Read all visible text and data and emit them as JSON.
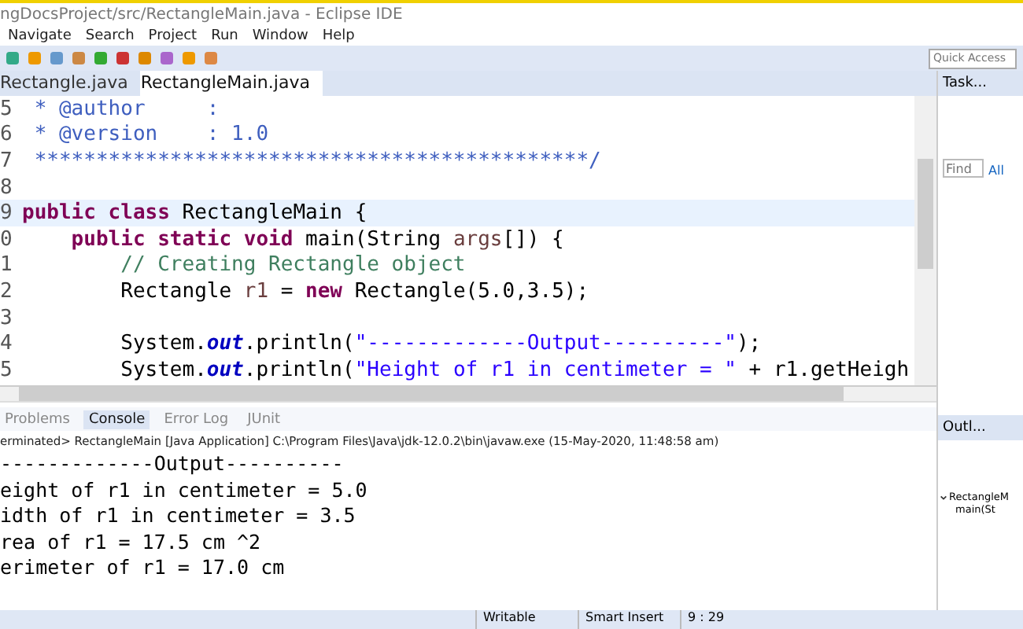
{
  "window": {
    "title": "ngDocsProject/src/RectangleMain.java - Eclipse IDE"
  },
  "menu": [
    "Navigate",
    "Search",
    "Project",
    "Run",
    "Window",
    "Help"
  ],
  "quick_access": {
    "placeholder": "Quick Access"
  },
  "editor_tabs": [
    {
      "label": "Rectangle.java",
      "selected": false
    },
    {
      "label": "RectangleMain.java",
      "selected": true
    }
  ],
  "code": [
    {
      "number": "5",
      "current": false,
      "tokens": [
        {
          "kind": "doc",
          "text": " * @author     :"
        }
      ]
    },
    {
      "number": "6",
      "current": false,
      "tokens": [
        {
          "kind": "doc",
          "text": " * @version    : 1.0"
        }
      ]
    },
    {
      "number": "7",
      "current": false,
      "tokens": [
        {
          "kind": "doc",
          "text": " *********************************************/"
        }
      ]
    },
    {
      "number": "8",
      "current": false
    },
    {
      "number": "9",
      "current": true,
      "tokens": [
        {
          "kind": "keyword",
          "text": "public class "
        },
        {
          "kind": "plain",
          "text": "RectangleMain {"
        }
      ]
    },
    {
      "number": "0",
      "current": false,
      "tokens": [
        {
          "kind": "keyword",
          "text": "    public static void "
        },
        {
          "kind": "plain",
          "text": "main(String "
        },
        {
          "kind": "param",
          "text": "args"
        },
        {
          "kind": "plain",
          "text": "[]) {"
        }
      ]
    },
    {
      "number": "1",
      "current": false,
      "tokens": [
        {
          "kind": "comment",
          "text": "        // Creating Rectangle object"
        }
      ]
    },
    {
      "number": "2",
      "current": false,
      "tokens": [
        {
          "kind": "plain",
          "text": "        Rectangle "
        },
        {
          "kind": "local",
          "text": "r1"
        },
        {
          "kind": "plain",
          "text": " = "
        },
        {
          "kind": "keyword",
          "text": "new "
        },
        {
          "kind": "plain",
          "text": "Rectangle(5.0,3.5);"
        }
      ]
    },
    {
      "number": "3",
      "current": false
    },
    {
      "number": "4",
      "current": false,
      "tokens": [
        {
          "kind": "plain",
          "text": "        System."
        },
        {
          "kind": "field",
          "text": "out"
        },
        {
          "kind": "plain",
          "text": ".println("
        },
        {
          "kind": "string",
          "text": "\"-------------Output----------\""
        },
        {
          "kind": "plain",
          "text": ");"
        }
      ]
    },
    {
      "number": "5",
      "current": false,
      "tokens": [
        {
          "kind": "plain",
          "text": "        System."
        },
        {
          "kind": "field",
          "text": "out"
        },
        {
          "kind": "plain",
          "text": ".println("
        },
        {
          "kind": "string",
          "text": "\"Height of r1 in centimeter = \""
        },
        {
          "kind": "plain",
          "text": " + r1.getHeigh"
        }
      ]
    }
  ],
  "console_tabs": [
    {
      "label": "Problems",
      "selected": false
    },
    {
      "label": "Console",
      "selected": true
    },
    {
      "label": "Error Log",
      "selected": false
    },
    {
      "label": "JUnit",
      "selected": false
    }
  ],
  "console_header": "erminated> RectangleMain [Java Application] C:\\Program Files\\Java\\jdk-12.0.2\\bin\\javaw.exe (15-May-2020, 11:48:58 am)",
  "console_output": [
    "-------------Output----------",
    "eight of r1 in centimeter = 5.0",
    "idth of r1 in centimeter = 3.5",
    "rea of r1 = 17.5 cm ^2",
    "erimeter of r1 = 17.0 cm"
  ],
  "task_panel": {
    "title": "Task...",
    "find": {
      "placeholder": "Find"
    },
    "filter": "All"
  },
  "outline_panel": {
    "title": "Outl...",
    "items": [
      {
        "label": "RectangleM",
        "expanded": true,
        "children": [
          {
            "label": "main(St"
          }
        ]
      }
    ]
  },
  "status_bar": [
    "Writable",
    "Smart Insert",
    "9 : 29"
  ]
}
